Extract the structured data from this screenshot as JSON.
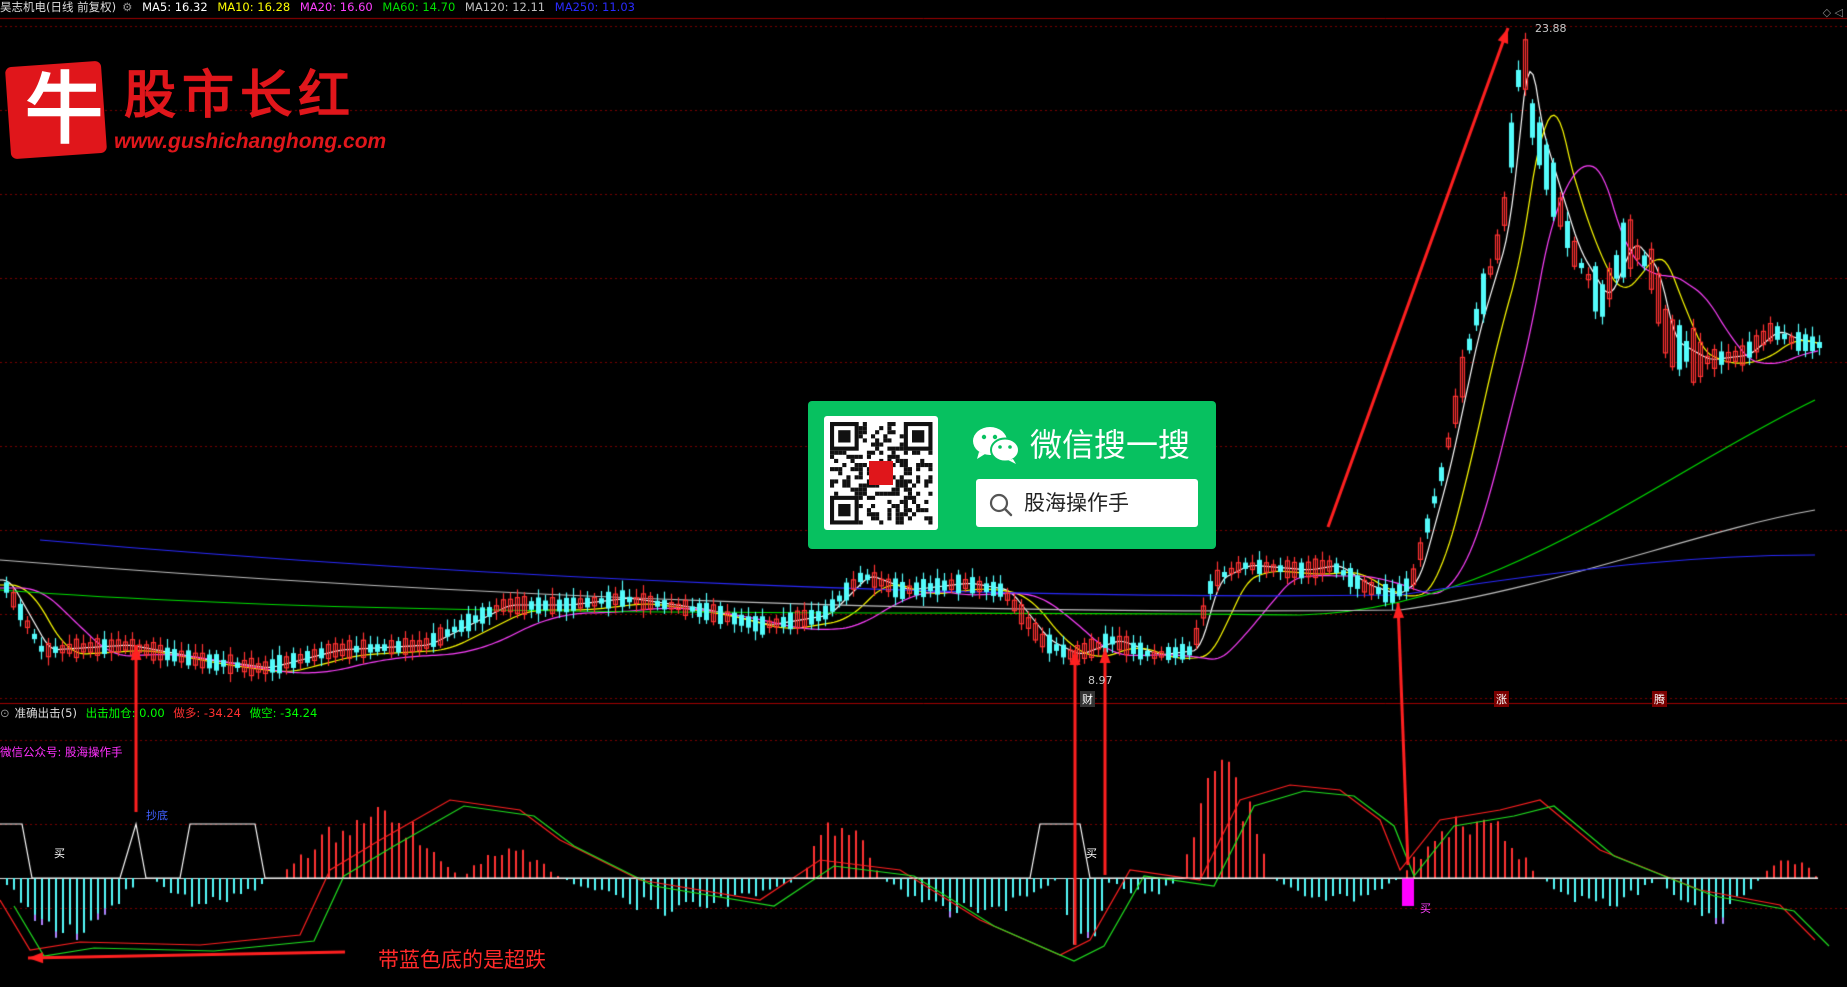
{
  "header": {
    "stock": "昊志机电(日线 前复权)",
    "ma": [
      {
        "label": "MA5: 16.32",
        "color": "#ffffff"
      },
      {
        "label": "MA10: 16.28",
        "color": "#ffff00"
      },
      {
        "label": "MA20: 16.60",
        "color": "#ff40ff"
      },
      {
        "label": "MA60: 14.70",
        "color": "#00e000"
      },
      {
        "label": "MA120: 12.11",
        "color": "#c0c0c0"
      },
      {
        "label": "MA250: 11.03",
        "color": "#2a2aff"
      }
    ],
    "right_icons": "◇ ◁"
  },
  "logo": {
    "char": "牛",
    "title": "股市长红",
    "url": "www.gushichanghong.com"
  },
  "wechat_card": {
    "title": "微信搜一搜",
    "search_text": "股海操作手"
  },
  "price_labels": {
    "peak": "23.88",
    "low": "8.97"
  },
  "event_tags": [
    "财",
    "涨",
    "腾"
  ],
  "indicator": {
    "name": "准确出击(5)",
    "items": [
      {
        "label": "出击加仓: 0.00",
        "color": "#00ff00"
      },
      {
        "label": "做多: -34.24",
        "color": "#ff3030"
      },
      {
        "label": "做空: -34.24",
        "color": "#00ff00"
      }
    ],
    "wechat_label": "微信公众号: 股海操作手",
    "annotations": [
      "抄底",
      "买",
      "买",
      "买"
    ]
  },
  "note": "带蓝色底的是超跌",
  "colors": {
    "up": "#ff3232",
    "down": "#54fcfc",
    "grid": "#7a0000",
    "arrow": "#ff2020"
  }
}
